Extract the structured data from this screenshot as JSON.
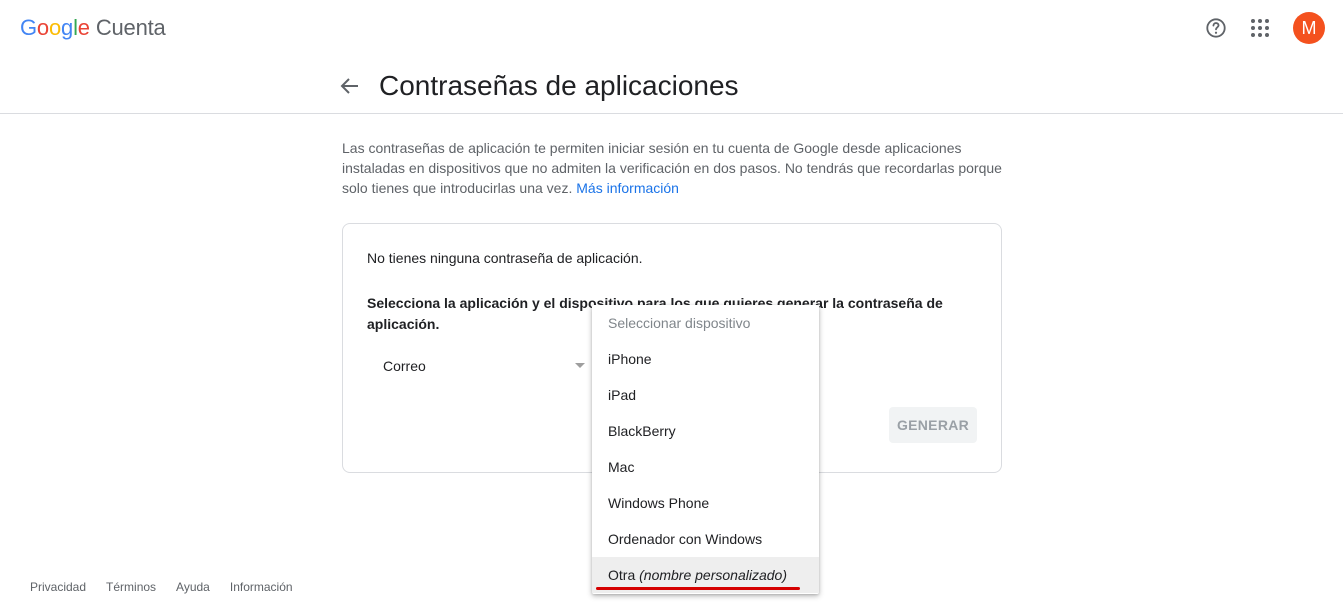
{
  "header": {
    "logo_letters": [
      "G",
      "o",
      "o",
      "g",
      "l",
      "e"
    ],
    "product": "Cuenta",
    "avatar_initial": "M",
    "icons": [
      "help-icon",
      "apps-grid-icon"
    ]
  },
  "page": {
    "title": "Contraseñas de aplicaciones",
    "description": "Las contraseñas de aplicación te permiten iniciar sesión en tu cuenta de Google desde aplicaciones instaladas en dispositivos que no admiten la verificación en dos pasos. No tendrás que recordarlas porque solo tienes que introducirlas una vez.",
    "more_info_link": "Más información"
  },
  "card": {
    "none_text": "No tienes ninguna contraseña de aplicación.",
    "instruction": "Selecciona la aplicación y el dispositivo para los que quieres generar la contraseña de aplicación.",
    "app_select_value": "Correo",
    "generate_button": "GENERAR"
  },
  "dropdown": {
    "placeholder": "Seleccionar dispositivo",
    "options": [
      "iPhone",
      "iPad",
      "BlackBerry",
      "Mac",
      "Windows Phone",
      "Ordenador con Windows"
    ],
    "other_prefix": "Otra",
    "other_suffix": "(nombre personalizado)"
  },
  "footer": {
    "links": [
      "Privacidad",
      "Términos",
      "Ayuda",
      "Información"
    ]
  },
  "colors": {
    "accent_link": "#1a73e8",
    "avatar_bg": "#f4511e",
    "highlight_underline": "#d50000"
  }
}
